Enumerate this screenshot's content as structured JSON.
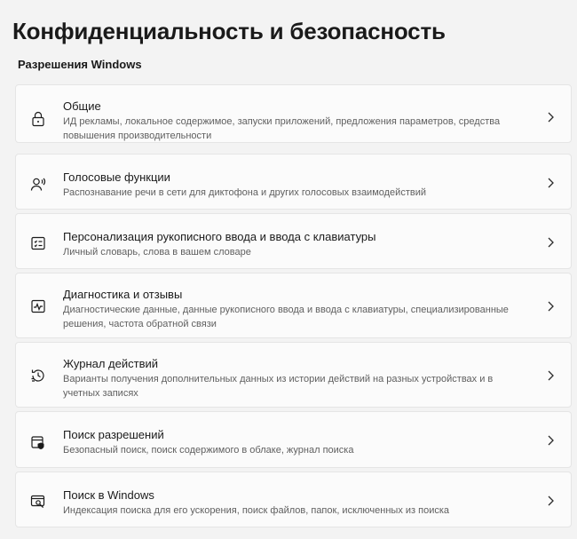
{
  "header": {
    "title": "Конфиденциальность и безопасность"
  },
  "section": {
    "title": "Разрешения Windows"
  },
  "items": [
    {
      "icon": "lock-icon",
      "title": "Общие",
      "description": "ИД рекламы, локальное содержимое, запуски приложений, предложения параметров, средства повышения производительности"
    },
    {
      "icon": "speech-icon",
      "title": "Голосовые функции",
      "description": "Распознавание речи в сети для диктофона и других голосовых взаимодействий"
    },
    {
      "icon": "handwriting-icon",
      "title": "Персонализация рукописного ввода и ввода с клавиатуры",
      "description": "Личный словарь, слова в вашем словаре"
    },
    {
      "icon": "diagnostics-icon",
      "title": "Диагностика и отзывы",
      "description": "Диагностические данные, данные рукописного ввода и ввода с клавиатуры, специализированные решения, частота обратной связи"
    },
    {
      "icon": "history-icon",
      "title": "Журнал действий",
      "description": "Варианты получения дополнительных данных из истории действий на разных устройствах и в учетных записях"
    },
    {
      "icon": "search-permissions-icon",
      "title": "Поиск разрешений",
      "description": "Безопасный поиск, поиск содержимого в облаке, журнал поиска"
    },
    {
      "icon": "search-windows-icon",
      "title": "Поиск в Windows",
      "description": "Индексация поиска для его ускорения, поиск файлов, папок, исключенных из поиска"
    }
  ]
}
